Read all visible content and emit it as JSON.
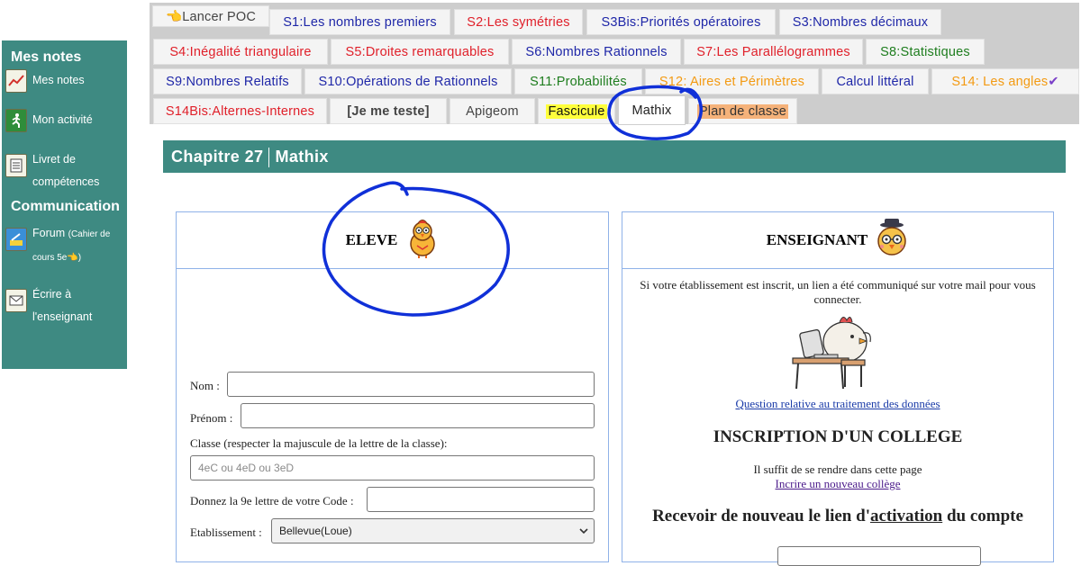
{
  "sidebar": {
    "section1": "Mes notes",
    "items1": [
      {
        "label": "Mes notes",
        "icon": "chart-icon"
      },
      {
        "label": "Mon activité",
        "icon": "running-man-icon"
      },
      {
        "label": "Livret de compétences",
        "line1": "Livret de",
        "line2": "compétences",
        "icon": "booklet-icon"
      }
    ],
    "section2": "Communication",
    "items2": [
      {
        "label": "Forum",
        "extra1": "(Cahier de",
        "extra2": "cours 5e👈)",
        "icon": "forum-icon"
      },
      {
        "label": "Écrire à l'enseignant",
        "line1": "Écrire à",
        "line2": "l'enseignant",
        "icon": "envelope-icon"
      }
    ]
  },
  "tabs": {
    "row0": [
      {
        "label": "👈Lancer POC",
        "color": "#333333"
      },
      {
        "label": "S1:Les nombres premiers"
      },
      {
        "label": "S2:Les symétries"
      },
      {
        "label": "S3Bis:Priorités opératoires"
      },
      {
        "label": "S3:Nombres décimaux"
      }
    ],
    "row1": [
      {
        "label": "S4:Inégalité triangulaire"
      },
      {
        "label": "S5:Droites remarquables"
      },
      {
        "label": "S6:Nombres Rationnels"
      },
      {
        "label": "S7:Les Parallélogrammes"
      },
      {
        "label": "S8:Statistiques"
      }
    ],
    "row2": [
      {
        "label": "S9:Nombres Relatifs"
      },
      {
        "label": "S10:Opérations de Rationnels"
      },
      {
        "label": "S11:Probabilités"
      },
      {
        "label": "S12: Aires et Périmètres"
      },
      {
        "label": "Calcul littéral"
      },
      {
        "label": "S14: Les angles",
        "check": "✔"
      }
    ],
    "row3": [
      {
        "label": "S14Bis:Alternes-Internes"
      },
      {
        "label": "[Je me teste]"
      },
      {
        "label": "Apigeom"
      },
      {
        "label": "Fascicule"
      },
      {
        "label": "Mathix"
      },
      {
        "label": "Plan de classe"
      }
    ]
  },
  "chapter": {
    "number": "Chapitre 27",
    "name": "Mathix"
  },
  "eleve": {
    "title": "ELEVE",
    "nom_label": "Nom :",
    "prenom_label": "Prénom :",
    "classe_label": "Classe (respecter la majuscule de la lettre de la classe):",
    "classe_placeholder": "4eC ou 4eD ou 3eD",
    "code_label": "Donnez la 9e lettre de votre Code :",
    "etab_label": "Etablissement :",
    "etab_value": "Bellevue(Loue)"
  },
  "enseignant": {
    "title": "ENSEIGNANT",
    "intro_line1": "Si votre établissement est inscrit, un lien a été communiqué sur votre mail pour vous",
    "intro_line2": "connecter.",
    "link_question": "Question relative au traitement des données",
    "inscription_title": "INSCRIPTION D'UN COLLEGE",
    "suffit": "Il suffit de se rendre dans cette page",
    "link_incrire": "Incrire un nouveau collège",
    "recevoir_pre": "Recevoir de nouveau le lien d'",
    "recevoir_act": "activation",
    "recevoir_post": " du compte"
  },
  "colors": {
    "sidebar": "#3e8a82",
    "tab_red": "#e0202a",
    "tab_blue": "#1f27a8",
    "tab_green": "#1e7d1e",
    "tab_orange": "#f39a12",
    "annotation": "#1030d8"
  }
}
